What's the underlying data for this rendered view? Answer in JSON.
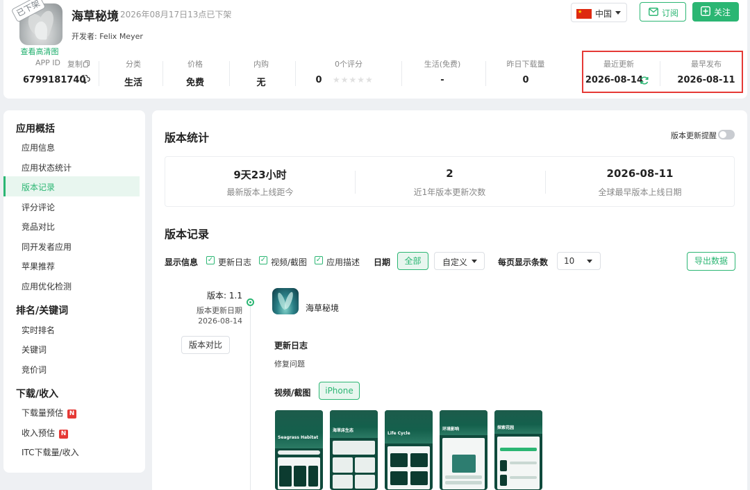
{
  "app": {
    "name": "海草秘境",
    "delisted_note": "2026年08月17日13点已下架",
    "delisted_badge": "已下架",
    "developer": "开发者: Felix Meyer",
    "hd_image_link": "查看高清图",
    "country": "中国",
    "subscribe_label": "订阅",
    "follow_label": "关注"
  },
  "stats": [
    {
      "label": "APP ID",
      "extra": "复制",
      "value": "6799181740"
    },
    {
      "label": "分类",
      "value": "生活"
    },
    {
      "label": "价格",
      "value": "免费"
    },
    {
      "label": "内购",
      "value": "无"
    },
    {
      "label": "0个评分",
      "value": "0"
    },
    {
      "label": "生活(免费)",
      "value": "-"
    },
    {
      "label": "昨日下载量",
      "value": "0"
    },
    {
      "label": "最近更新",
      "value": "2026-08-14"
    },
    {
      "label": "最早发布",
      "value": "2026-08-11"
    }
  ],
  "sidebar": {
    "groups": [
      {
        "title": "应用概括",
        "items": [
          "应用信息",
          "应用状态统计",
          "版本记录",
          "评分评论",
          "竞品对比",
          "同开发者应用",
          "苹果推荐",
          "应用优化检测"
        ]
      },
      {
        "title": "排名/关键词",
        "items": [
          "实时排名",
          "关键词",
          "竞价词"
        ]
      },
      {
        "title": "下载/收入",
        "items": [
          "下载量预估",
          "收入预估",
          "ITC下载量/收入"
        ]
      }
    ],
    "active": "版本记录",
    "badge": "N"
  },
  "main": {
    "version_stats_title": "版本统计",
    "reminder_label": "版本更新提醒",
    "summary": [
      {
        "value": "9天23小时",
        "caption": "最新版本上线距今"
      },
      {
        "value": "2",
        "caption": "近1年版本更新次数"
      },
      {
        "value": "2026-08-11",
        "caption": "全球最早版本上线日期"
      }
    ],
    "records_title": "版本记录",
    "filters": {
      "display_label": "显示信息",
      "checkboxes": [
        "更新日志",
        "视频/截图",
        "应用描述"
      ],
      "date_label": "日期",
      "date_all": "全部",
      "date_custom": "自定义",
      "per_page_label": "每页显示条数",
      "per_page_value": "10",
      "export_label": "导出数据"
    },
    "record": {
      "version": "版本: 1.1",
      "date_caption": "版本更新日期",
      "date": "2026-08-14",
      "compare_label": "版本对比",
      "app_name": "海草秘境",
      "changelog_title": "更新日志",
      "changelog_text": "修复问题",
      "media_title": "视频/截图",
      "device_tab": "iPhone",
      "screenshots": [
        "Seagrass Habitat",
        "海草床生态",
        "Life Cycle",
        "环境影响",
        "探索花园"
      ]
    }
  },
  "colors": {
    "accent": "#2bb673",
    "highlight": "#e53935",
    "badge": "#e53935"
  }
}
